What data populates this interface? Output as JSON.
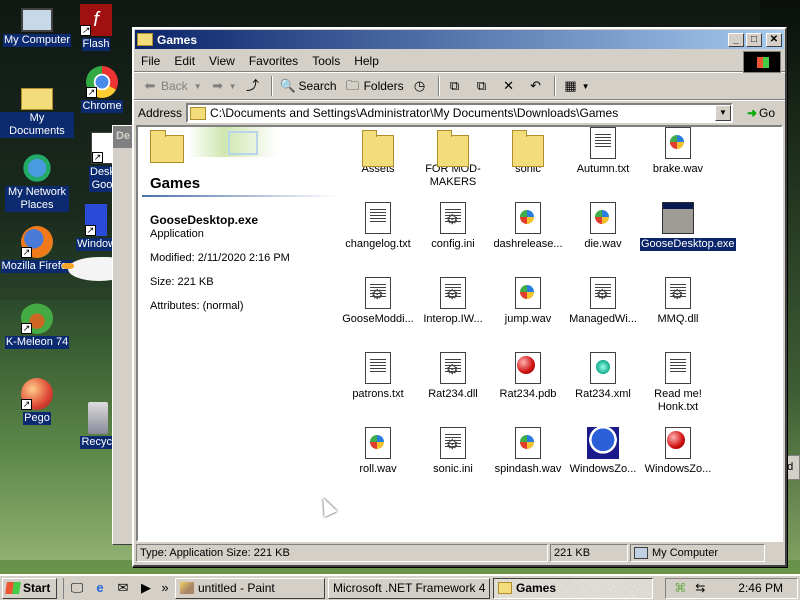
{
  "desktop": {
    "icons": [
      {
        "label": "My Computer"
      },
      {
        "label": "My Documents"
      },
      {
        "label": "My Network Places"
      },
      {
        "label": "Mozilla Firefox"
      },
      {
        "label": "K-Meleon 74"
      },
      {
        "label": "Pego"
      },
      {
        "label": "Flash"
      },
      {
        "label": "Chrome"
      },
      {
        "label": "Desk Goo"
      },
      {
        "label": "Window"
      },
      {
        "label": "Recycl"
      }
    ],
    "back_window_title": "De",
    "back_window_right_text": "ed"
  },
  "window": {
    "title": "Games",
    "controls": {
      "minimize": "_",
      "maximize": "□",
      "close": "✕"
    },
    "menu": [
      "File",
      "Edit",
      "View",
      "Favorites",
      "Tools",
      "Help"
    ],
    "toolbar": {
      "back": "Back",
      "search": "Search",
      "folders": "Folders"
    },
    "address": {
      "label": "Address",
      "value": "C:\\Documents and Settings\\Administrator\\My Documents\\Downloads\\Games",
      "go": "Go"
    },
    "left_pane": {
      "folder_title": "Games",
      "file_name": "GooseDesktop.exe",
      "file_type": "Application",
      "modified": "Modified: 2/11/2020 2:16 PM",
      "size": "Size: 221 KB",
      "attributes": "Attributes: (normal)"
    },
    "files": [
      {
        "name": "Assets",
        "icon": "folder-icon"
      },
      {
        "name": "FOR MOD-MAKERS",
        "icon": "folder-icon"
      },
      {
        "name": "sonic",
        "icon": "folder-icon"
      },
      {
        "name": "Autumn.txt",
        "icon": "text-file-icon"
      },
      {
        "name": "brake.wav",
        "icon": "media-file-icon"
      },
      {
        "name": "changelog.txt",
        "icon": "text-file-icon"
      },
      {
        "name": "config.ini",
        "icon": "config-file-icon"
      },
      {
        "name": "dashrelease...",
        "icon": "media-file-icon"
      },
      {
        "name": "die.wav",
        "icon": "media-file-icon"
      },
      {
        "name": "GooseDesktop.exe",
        "icon": "application-icon",
        "selected": true
      },
      {
        "name": "GooseModdi...",
        "icon": "dll-file-icon"
      },
      {
        "name": "Interop.IW...",
        "icon": "dll-file-icon"
      },
      {
        "name": "jump.wav",
        "icon": "media-file-icon"
      },
      {
        "name": "ManagedWi...",
        "icon": "dll-file-icon"
      },
      {
        "name": "MMQ.dll",
        "icon": "dll-file-icon"
      },
      {
        "name": "patrons.txt",
        "icon": "text-file-icon"
      },
      {
        "name": "Rat234.dll",
        "icon": "dll-file-icon"
      },
      {
        "name": "Rat234.pdb",
        "icon": "pdb-file-icon"
      },
      {
        "name": "Rat234.xml",
        "icon": "xml-file-icon"
      },
      {
        "name": "Read me! Honk.txt",
        "icon": "text-file-icon"
      },
      {
        "name": "roll.wav",
        "icon": "media-file-icon"
      },
      {
        "name": "sonic.ini",
        "icon": "config-file-icon"
      },
      {
        "name": "spindash.wav",
        "icon": "media-file-icon"
      },
      {
        "name": "WindowsZo...",
        "icon": "sonic-image-icon"
      },
      {
        "name": "WindowsZo...",
        "icon": "pdb-file-icon"
      }
    ],
    "status": {
      "info": "Type: Application Size: 221 KB",
      "size": "221 KB",
      "zone": "My Computer"
    }
  },
  "taskbar": {
    "start": "Start",
    "tasks": [
      {
        "label": "untitled - Paint",
        "active": false
      },
      {
        "label": "Microsoft .NET Framework 4 ...",
        "active": false
      },
      {
        "label": "Games",
        "active": true
      }
    ],
    "clock": "2:46 PM"
  },
  "colors": {
    "title_active_start": "#0a246a",
    "title_active_end": "#a6caf0",
    "selection": "#0a246a",
    "chrome": "#d4d0c8"
  }
}
